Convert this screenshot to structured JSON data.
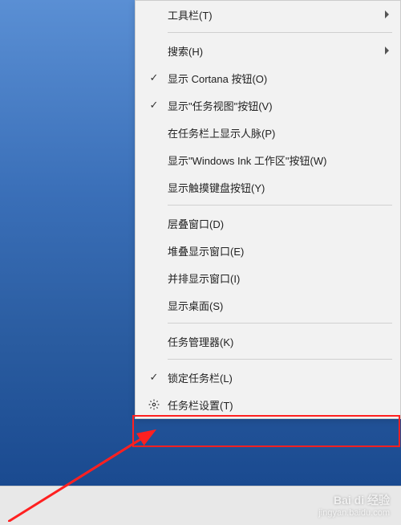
{
  "menu": {
    "groups": [
      [
        {
          "id": "toolbars",
          "label": "工具栏(T)",
          "checked": false,
          "submenu": true
        }
      ],
      [
        {
          "id": "search",
          "label": "搜索(H)",
          "checked": false,
          "submenu": true
        },
        {
          "id": "cortana-button",
          "label": "显示 Cortana 按钮(O)",
          "checked": true
        },
        {
          "id": "task-view-button",
          "label": "显示\"任务视图\"按钮(V)",
          "checked": true
        },
        {
          "id": "people",
          "label": "在任务栏上显示人脉(P)",
          "checked": false
        },
        {
          "id": "windows-ink",
          "label": "显示\"Windows Ink 工作区\"按钮(W)",
          "checked": false
        },
        {
          "id": "touch-keyboard",
          "label": "显示触摸键盘按钮(Y)",
          "checked": false
        }
      ],
      [
        {
          "id": "cascade",
          "label": "层叠窗口(D)",
          "checked": false
        },
        {
          "id": "stacked",
          "label": "堆叠显示窗口(E)",
          "checked": false
        },
        {
          "id": "side-by-side",
          "label": "并排显示窗口(I)",
          "checked": false
        },
        {
          "id": "show-desktop",
          "label": "显示桌面(S)",
          "checked": false
        }
      ],
      [
        {
          "id": "task-manager",
          "label": "任务管理器(K)",
          "checked": false
        }
      ],
      [
        {
          "id": "lock-taskbar",
          "label": "锁定任务栏(L)",
          "checked": true
        },
        {
          "id": "taskbar-settings",
          "label": "任务栏设置(T)",
          "checked": false,
          "icon": "gear"
        }
      ]
    ]
  },
  "watermark": {
    "brand": "Bai di 经验",
    "url": "jingyan.baidu.com"
  }
}
